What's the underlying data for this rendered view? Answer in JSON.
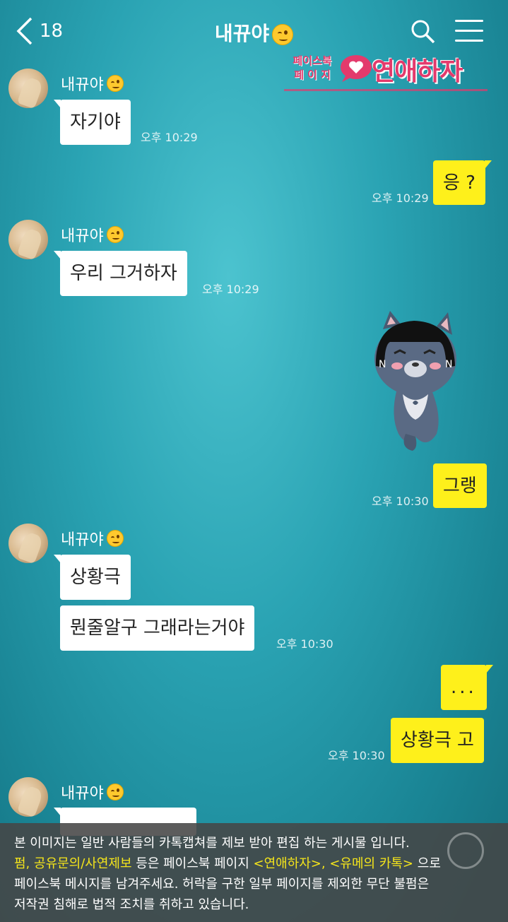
{
  "header": {
    "back_count": "18",
    "title": "내뀨야"
  },
  "watermark": {
    "small_line1": "페이스북",
    "small_line2": "페 이 지",
    "big": "연애하자"
  },
  "messages": [
    {
      "sender": "내뀨야",
      "text": "자기야",
      "time": "오후 10:29"
    },
    {
      "text": "응 ?",
      "time": "오후 10:29"
    },
    {
      "sender": "내뀨야",
      "text": "우리 그거하자",
      "time": "오후 10:29"
    },
    {
      "text": "그랭",
      "time": "오후 10:30"
    },
    {
      "sender": "내뀨야",
      "text": "상황극",
      "text2": "뭔줄알구 그래라는거야",
      "time": "오후 10:30"
    },
    {
      "text": "...",
      "text2": "상황극 고",
      "time": "오후 10:30"
    },
    {
      "sender": "내뀨야"
    }
  ],
  "notice": {
    "line1": "본 이미지는 일반 사람들의 카톡캡쳐를 제보 받아 편집 하는 게시물 입니다.",
    "line2_hl": "펌, 공유문의/사연제보",
    "line2_a": " 등은 페이스북 페이지 ",
    "line2_hl2": "<연애하자>, <유메의 카톡>",
    "line2_b": " 으로",
    "line3": "페이스북 메시지를 남겨주세요. 허락을 구한 일부 페이지를 제외한 무단 불펌은",
    "line4": "저작권 침해로 법적 조치를 취하고 있습니다."
  },
  "colors": {
    "incoming_bubble": "#ffffff",
    "outgoing_bubble": "#fef01b",
    "highlight": "#f5e51b",
    "watermark": "#e33a6c"
  }
}
